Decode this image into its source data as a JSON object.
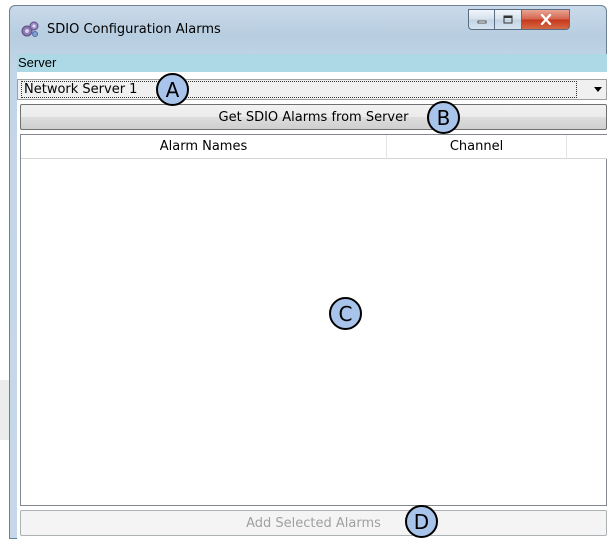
{
  "window": {
    "title": "SDIO Configuration Alarms",
    "controls": {
      "minimize": "minimize",
      "maximize": "maximize",
      "close": "close"
    }
  },
  "server": {
    "label": "Server",
    "selected_value": "Network Server 1"
  },
  "get_button": {
    "label": "Get SDIO Alarms from Server"
  },
  "alarm_list": {
    "columns": [
      "Alarm Names",
      "Channel"
    ],
    "rows": []
  },
  "add_button": {
    "label": "Add Selected Alarms",
    "enabled": false
  },
  "callouts": [
    "A",
    "B",
    "C",
    "D"
  ],
  "colors": {
    "server_label_bg": "#add8e6",
    "callout_fill": "#a9c4ea",
    "close_button": "#c7361a"
  }
}
